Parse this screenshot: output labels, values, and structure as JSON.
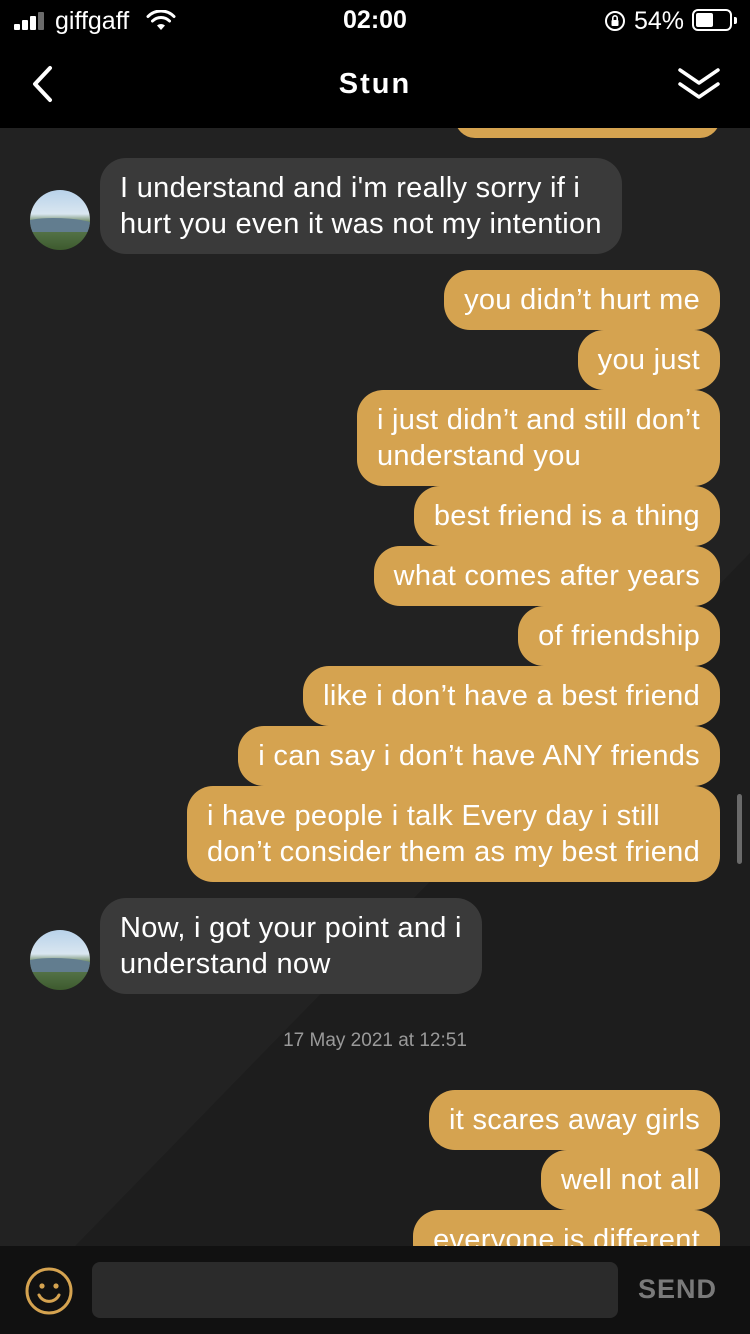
{
  "status_bar": {
    "carrier": "giffgaff",
    "time": "02:00",
    "battery_percent": "54%",
    "battery_level": 0.54,
    "icons": [
      "signal-icon",
      "wifi-icon",
      "rotation-lock-icon",
      "battery-icon"
    ]
  },
  "header": {
    "title": "Stun",
    "back_icon": "chevron-left-icon",
    "menu_icon": "double-chevron-down-icon"
  },
  "messages": [
    {
      "from": "other",
      "text_lines": [
        "I understand and i'm really sorry if i",
        "hurt you even it was not my intention"
      ]
    },
    {
      "from": "me",
      "text_lines": [
        "you didn’t hurt me"
      ]
    },
    {
      "from": "me",
      "text_lines": [
        "you just"
      ]
    },
    {
      "from": "me",
      "text_lines": [
        "i just didn’t and still don’t",
        "understand you"
      ]
    },
    {
      "from": "me",
      "text_lines": [
        "best friend is a thing"
      ]
    },
    {
      "from": "me",
      "text_lines": [
        "what comes after years"
      ]
    },
    {
      "from": "me",
      "text_lines": [
        "of friendship"
      ]
    },
    {
      "from": "me",
      "text_lines": [
        "like i don’t have a best friend"
      ]
    },
    {
      "from": "me",
      "text_lines": [
        "i can say i don’t have ANY friends"
      ]
    },
    {
      "from": "me",
      "text_lines": [
        "i have people i talk Every day i still",
        "don’t consider them as my best friend"
      ]
    },
    {
      "from": "other",
      "text_lines": [
        "Now, i got your point and i",
        "understand now"
      ]
    },
    {
      "from": "me",
      "text_lines": [
        "it scares away girls"
      ]
    },
    {
      "from": "me",
      "text_lines": [
        "well not all"
      ]
    },
    {
      "from": "me",
      "text_lines": [
        "everyone is different"
      ]
    }
  ],
  "timestamp": "17 May 2021 at 12:51",
  "composer": {
    "placeholder": "",
    "send_label": "SEND",
    "emoji_icon": "smiley-face-icon"
  },
  "colors": {
    "outgoing_bubble": "#d5a350",
    "incoming_bubble": "#3a3a3a",
    "background": "#1d1d1d",
    "header": "#000000"
  }
}
